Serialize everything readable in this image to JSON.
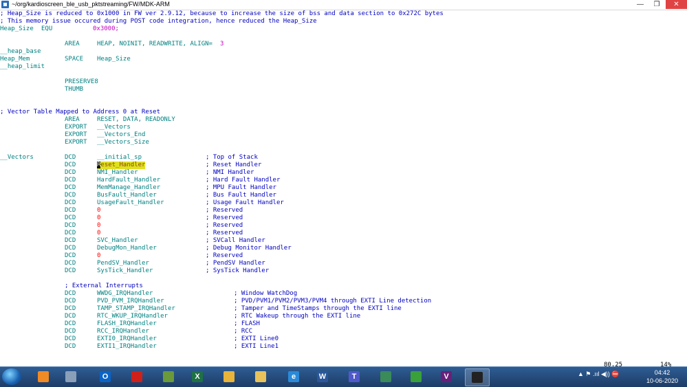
{
  "window": {
    "title": "~/org/kardioscreen_ble_usb_pktstreaming/FW/MDK-ARM"
  },
  "editor": {
    "comment1": "; Heap_Size is reduced to 0x1000 in FW ver 2.9.12, because to increase the size of bss and data section to 0x272C bytes",
    "comment2": "; This memory issue occured during POST code integration, hence reduced the Heap_Size",
    "heap_size_label": "Heap_Size",
    "equ": "EQU",
    "heap_size_val": "0x3000;",
    "area": "AREA",
    "heap_area_args": "HEAP, NOINIT, READWRITE, ALIGN=",
    "align_val": "3",
    "heap_base": "__heap_base",
    "heap_mem": "Heap_Mem",
    "space": "SPACE",
    "space_arg": "Heap_Size",
    "heap_limit": "__heap_limit",
    "preserve8": "PRESERVE8",
    "thumb": "THUMB",
    "vector_comment": "; Vector Table Mapped to Address 0 at Reset",
    "reset_area_args": "RESET, DATA, READONLY",
    "export": "EXPORT",
    "exp1": "__Vectors",
    "exp2": "__Vectors_End",
    "exp3": "__Vectors_Size",
    "vectors_label": "__Vectors",
    "dcd": "DCD",
    "vectors": [
      {
        "handler": "__initial_sp",
        "comment": "; Top of Stack"
      },
      {
        "handler": "Reset_Handler",
        "comment": "; Reset Handler"
      },
      {
        "handler": "NMI_Handler",
        "comment": "; NMI Handler"
      },
      {
        "handler": "HardFault_Handler",
        "comment": "; Hard Fault Handler"
      },
      {
        "handler": "MemManage_Handler",
        "comment": "; MPU Fault Handler"
      },
      {
        "handler": "BusFault_Handler",
        "comment": "; Bus Fault Handler"
      },
      {
        "handler": "UsageFault_Handler",
        "comment": "; Usage Fault Handler"
      },
      {
        "handler": "0",
        "comment": "; Reserved"
      },
      {
        "handler": "0",
        "comment": "; Reserved"
      },
      {
        "handler": "0",
        "comment": "; Reserved"
      },
      {
        "handler": "0",
        "comment": "; Reserved"
      },
      {
        "handler": "SVC_Handler",
        "comment": "; SVCall Handler"
      },
      {
        "handler": "DebugMon_Handler",
        "comment": "; Debug Monitor Handler"
      },
      {
        "handler": "0",
        "comment": "; Reserved"
      },
      {
        "handler": "PendSV_Handler",
        "comment": "; PendSV Handler"
      },
      {
        "handler": "SysTick_Handler",
        "comment": "; SysTick Handler"
      }
    ],
    "ext_comment": "; External Interrupts",
    "ext_vectors": [
      {
        "handler": "WWDG_IRQHandler",
        "comment": "; Window WatchDog"
      },
      {
        "handler": "PVD_PVM_IRQHandler",
        "comment": "; PVD/PVM1/PVM2/PVM3/PVM4 through EXTI Line detection"
      },
      {
        "handler": "TAMP_STAMP_IRQHandler",
        "comment": "; Tamper and TimeStamps through the EXTI line"
      },
      {
        "handler": "RTC_WKUP_IRQHandler",
        "comment": "; RTC Wakeup through the EXTI line"
      },
      {
        "handler": "FLASH_IRQHandler",
        "comment": "; FLASH"
      },
      {
        "handler": "RCC_IRQHandler",
        "comment": "; RCC"
      },
      {
        "handler": "EXTI0_IRQHandler",
        "comment": "; EXTI Line0"
      },
      {
        "handler": "EXTI1_IRQHandler",
        "comment": "; EXTI Line1"
      }
    ],
    "status_position": "80,25",
    "status_percent": "14%"
  },
  "taskbar": {
    "items": [
      {
        "icon": "media-player-icon",
        "label": "",
        "color": "#f08a24"
      },
      {
        "icon": "calculator-icon",
        "label": "",
        "color": "#8aa0b8"
      },
      {
        "icon": "outlook-icon",
        "label": "O",
        "color": "#0a64c8"
      },
      {
        "icon": "pdf-icon",
        "label": "",
        "color": "#d0201a"
      },
      {
        "icon": "chart-app-icon",
        "label": "",
        "color": "#6a9a3a"
      },
      {
        "icon": "excel-icon",
        "label": "X",
        "color": "#1e7145"
      },
      {
        "icon": "chrome-icon",
        "label": "",
        "color": "#e8b43a"
      },
      {
        "icon": "folder-icon",
        "label": "",
        "color": "#e8c25a"
      },
      {
        "icon": "ie-icon",
        "label": "e",
        "color": "#2a8ad8"
      },
      {
        "icon": "word-icon",
        "label": "W",
        "color": "#2b579a"
      },
      {
        "icon": "teams-icon",
        "label": "T",
        "color": "#5059c9"
      },
      {
        "icon": "terminal-app-icon",
        "label": "",
        "color": "#3a8a5a"
      },
      {
        "icon": "windows-app-icon",
        "label": "",
        "color": "#3aa03a"
      },
      {
        "icon": "visual-studio-icon",
        "label": "V",
        "color": "#68217a"
      },
      {
        "icon": "console-icon",
        "label": "",
        "color": "#222222"
      }
    ],
    "tray_text": "▲ ⚑ .ııl ◀)) ⛔",
    "time": "04:42",
    "date": "10-06-2020"
  }
}
